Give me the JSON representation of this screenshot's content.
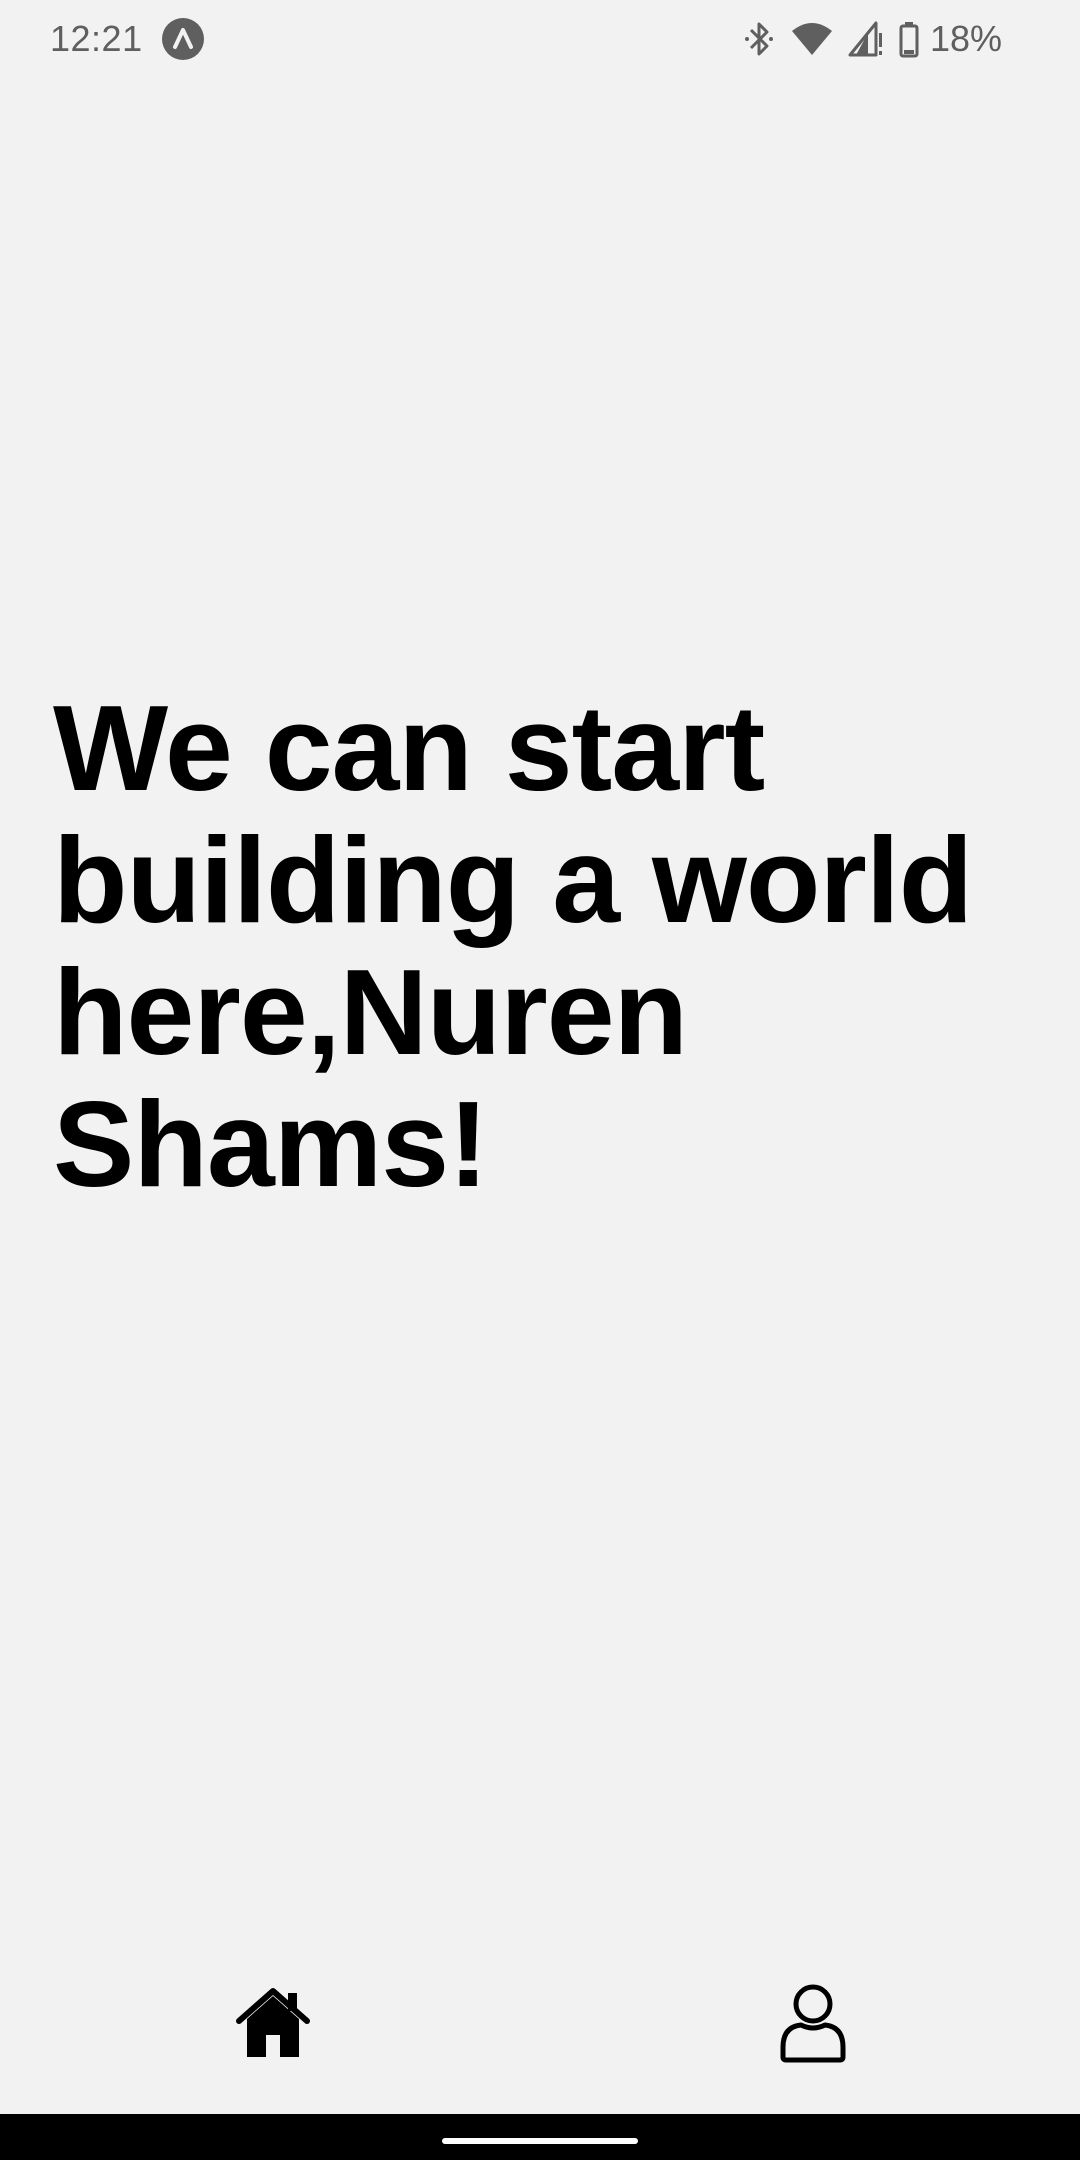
{
  "status_bar": {
    "time": "12:21",
    "app_indicator_icon": "app-notification-icon",
    "icons": [
      "bluetooth-icon",
      "wifi-icon",
      "signal-icon",
      "battery-icon"
    ],
    "battery_percent": "18%"
  },
  "main": {
    "headline": "We can start building a world here,Nuren Shams!"
  },
  "bottom_nav": {
    "items": [
      {
        "icon": "home-icon",
        "active": true
      },
      {
        "icon": "profile-icon",
        "active": false
      }
    ]
  },
  "colors": {
    "background": "#f2f2f2",
    "text": "#000000",
    "status": "#5f5f5f"
  }
}
